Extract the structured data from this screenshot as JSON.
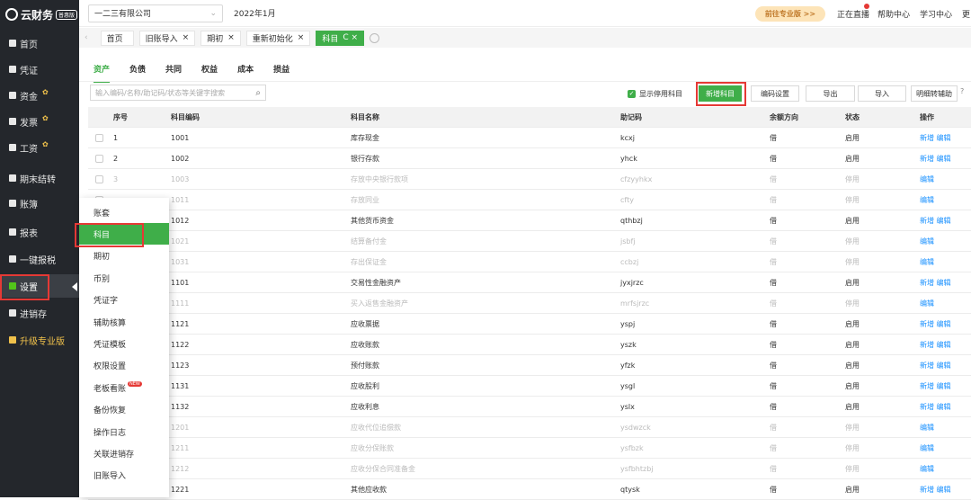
{
  "app": {
    "logo": "云财务",
    "version_badge": "普惠版"
  },
  "sidebar": {
    "items": [
      {
        "label": "首页",
        "hot": ""
      },
      {
        "label": "凭证",
        "hot": ""
      },
      {
        "label": "资金",
        "hot": "✿"
      },
      {
        "label": "发票",
        "hot": "✿"
      },
      {
        "label": "工资",
        "hot": "✿"
      },
      {
        "label": "期末结转",
        "hot": ""
      },
      {
        "label": "账簿",
        "hot": ""
      },
      {
        "label": "报表",
        "hot": ""
      },
      {
        "label": "一键报税",
        "hot": ""
      },
      {
        "label": "设置",
        "hot": ""
      },
      {
        "label": "进销存",
        "hot": ""
      },
      {
        "label": "升级专业版",
        "hot": ""
      }
    ]
  },
  "topbar": {
    "company": "一二三有限公司",
    "period": "2022年1月",
    "upgrade": "前往专业版 >>",
    "live": "正在直播",
    "help": "帮助中心",
    "learn": "学习中心",
    "more": "更"
  },
  "tabs": [
    {
      "label": "首页",
      "close": ""
    },
    {
      "label": "旧账导入",
      "close": "×"
    },
    {
      "label": "期初",
      "close": "×"
    },
    {
      "label": "重新初始化",
      "close": "×"
    },
    {
      "label": "科目",
      "close": "C ×"
    }
  ],
  "subtabs": [
    "资产",
    "负债",
    "共同",
    "权益",
    "成本",
    "损益"
  ],
  "search": {
    "placeholder": "输入编码/名称/助记码/状态等关键字搜索"
  },
  "toolbar": {
    "show_disabled": "显示停用科目",
    "add": "新增科目",
    "code_settings": "编码设置",
    "export": "导出",
    "import": "导入",
    "detail": "明细转辅助",
    "help": "?"
  },
  "table": {
    "headers": [
      "序号",
      "科目编码",
      "科目名称",
      "助记码",
      "余额方向",
      "状态",
      "操作"
    ],
    "rows": [
      {
        "no": "1",
        "code": "1001",
        "name": "库存现金",
        "mnemonic": "kcxj",
        "dir": "借",
        "status": "启用",
        "ops": "新增 编辑",
        "disabled": false
      },
      {
        "no": "2",
        "code": "1002",
        "name": "银行存款",
        "mnemonic": "yhck",
        "dir": "借",
        "status": "启用",
        "ops": "新增 编辑",
        "disabled": false
      },
      {
        "no": "3",
        "code": "1003",
        "name": "存放中央银行款项",
        "mnemonic": "cfzyyhkx",
        "dir": "借",
        "status": "停用",
        "ops": "编辑",
        "disabled": true
      },
      {
        "no": "",
        "code": "1011",
        "name": "存放同业",
        "mnemonic": "cfty",
        "dir": "借",
        "status": "停用",
        "ops": "编辑",
        "disabled": true
      },
      {
        "no": "",
        "code": "1012",
        "name": "其他货币资金",
        "mnemonic": "qthbzj",
        "dir": "借",
        "status": "启用",
        "ops": "新增 编辑",
        "disabled": false
      },
      {
        "no": "",
        "code": "1021",
        "name": "结算备付金",
        "mnemonic": "jsbfj",
        "dir": "借",
        "status": "停用",
        "ops": "编辑",
        "disabled": true
      },
      {
        "no": "",
        "code": "1031",
        "name": "存出保证金",
        "mnemonic": "ccbzj",
        "dir": "借",
        "status": "停用",
        "ops": "编辑",
        "disabled": true
      },
      {
        "no": "",
        "code": "1101",
        "name": "交易性金融资产",
        "mnemonic": "jyxjrzc",
        "dir": "借",
        "status": "启用",
        "ops": "新增 编辑",
        "disabled": false
      },
      {
        "no": "",
        "code": "1111",
        "name": "买入返售金融资产",
        "mnemonic": "mrfsjrzc",
        "dir": "借",
        "status": "停用",
        "ops": "编辑",
        "disabled": true
      },
      {
        "no": "",
        "code": "1121",
        "name": "应收票据",
        "mnemonic": "yspj",
        "dir": "借",
        "status": "启用",
        "ops": "新增 编辑",
        "disabled": false
      },
      {
        "no": "",
        "code": "1122",
        "name": "应收账款",
        "mnemonic": "yszk",
        "dir": "借",
        "status": "启用",
        "ops": "新增 编辑",
        "disabled": false
      },
      {
        "no": "",
        "code": "1123",
        "name": "预付账款",
        "mnemonic": "yfzk",
        "dir": "借",
        "status": "启用",
        "ops": "新增 编辑",
        "disabled": false
      },
      {
        "no": "",
        "code": "1131",
        "name": "应收股利",
        "mnemonic": "ysgl",
        "dir": "借",
        "status": "启用",
        "ops": "新增 编辑",
        "disabled": false
      },
      {
        "no": "",
        "code": "1132",
        "name": "应收利息",
        "mnemonic": "yslx",
        "dir": "借",
        "status": "启用",
        "ops": "新增 编辑",
        "disabled": false
      },
      {
        "no": "",
        "code": "1201",
        "name": "应收代位追偿款",
        "mnemonic": "ysdwzck",
        "dir": "借",
        "status": "停用",
        "ops": "编辑",
        "disabled": true
      },
      {
        "no": "",
        "code": "1211",
        "name": "应收分保账款",
        "mnemonic": "ysfbzk",
        "dir": "借",
        "status": "停用",
        "ops": "编辑",
        "disabled": true
      },
      {
        "no": "",
        "code": "1212",
        "name": "应收分保合同准备金",
        "mnemonic": "ysfbhtzbj",
        "dir": "借",
        "status": "停用",
        "ops": "编辑",
        "disabled": true
      },
      {
        "no": "",
        "code": "1221",
        "name": "其他应收款",
        "mnemonic": "qtysk",
        "dir": "借",
        "status": "启用",
        "ops": "新增 编辑",
        "disabled": false
      }
    ]
  },
  "dropdown": {
    "items": [
      "账套",
      "科目",
      "期初",
      "币别",
      "凭证字",
      "辅助核算",
      "凭证模板",
      "权限设置",
      "老板看账",
      "备份恢复",
      "操作日志",
      "关联进销存",
      "旧账导入"
    ],
    "new_badge": "NEW"
  },
  "colors": {
    "accent": "#3fae49",
    "sidebar_bg": "#24272c",
    "highlight": "#e53935",
    "link": "#1890ff"
  }
}
